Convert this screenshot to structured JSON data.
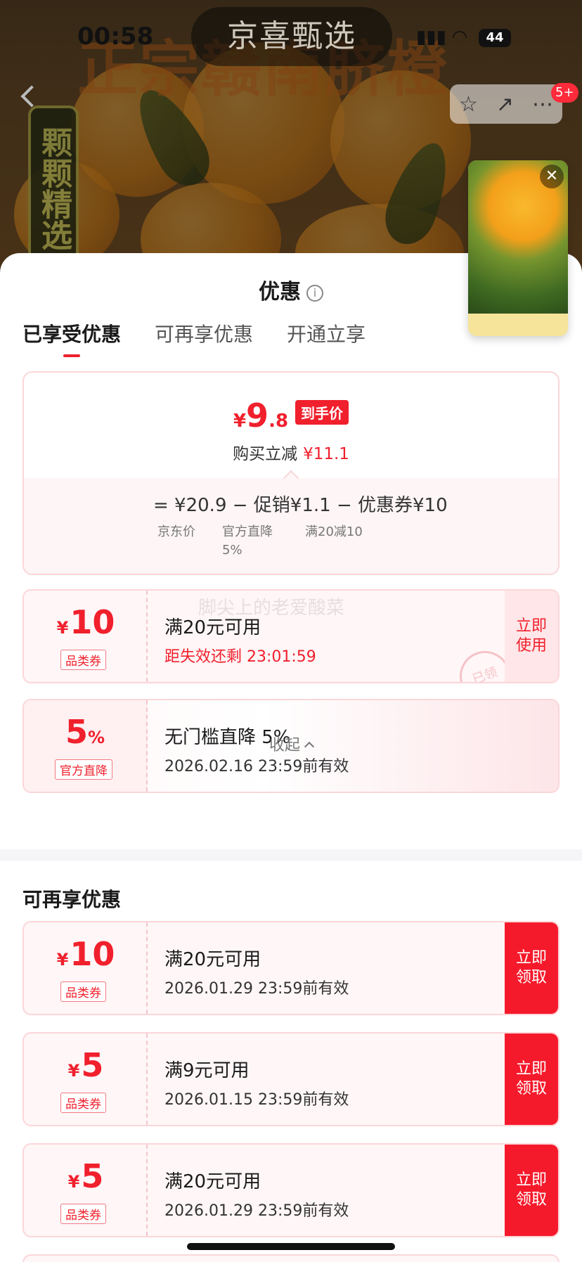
{
  "status_bar": {
    "time": "00:58",
    "battery": "44"
  },
  "island_text": "京喜甄选",
  "background": {
    "title": "正宗赣南脐橙",
    "badge": "颗颗精选"
  },
  "nav": {
    "notification_count": "5+"
  },
  "sheet": {
    "title": "优惠",
    "tabs": [
      "已享受优惠",
      "可再享优惠",
      "开通立享"
    ],
    "price": {
      "currency": "¥",
      "int": "9",
      "decimal": ".8",
      "tag": "到手价",
      "reduce_label": "购买立减",
      "reduce_value": "¥11.1"
    },
    "breakdown": {
      "line": "= ¥20.9 − 促销¥1.1 − 优惠券¥10",
      "jd_price_label": "京东价",
      "promo_label": "官方直降\n5%",
      "coupon_label": "满20减10"
    },
    "enjoyed": [
      {
        "currency": "¥",
        "amount": "10",
        "label": "品类券",
        "title": "满20元可用",
        "sub": "距失效还剩 23:01:59",
        "button": "立即\n使用",
        "stamp": "已领"
      },
      {
        "amount": "5",
        "unit": "%",
        "label": "官方直降",
        "title": "无门槛直降 5%",
        "sub": "2026.02.16 23:59前有效"
      }
    ],
    "collapse_label": "收起",
    "watermark": "脚尖上的老爱酸菜",
    "more_section_title": "可再享优惠",
    "more": [
      {
        "currency": "¥",
        "amount": "10",
        "label": "品类券",
        "title": "满20元可用",
        "sub": "2026.01.29 23:59前有效",
        "button": "立即\n领取"
      },
      {
        "currency": "¥",
        "amount": "5",
        "label": "品类券",
        "title": "满9元可用",
        "sub": "2026.01.15 23:59前有效",
        "button": "立即\n领取"
      },
      {
        "currency": "¥",
        "amount": "5",
        "label": "品类券",
        "title": "满20元可用",
        "sub": "2026.01.29 23:59前有效",
        "button": "立即\n领取"
      }
    ]
  },
  "colors": {
    "accent_red": "#f0202c",
    "button_red": "#f51a2b",
    "card_border": "#fbd6d9"
  }
}
